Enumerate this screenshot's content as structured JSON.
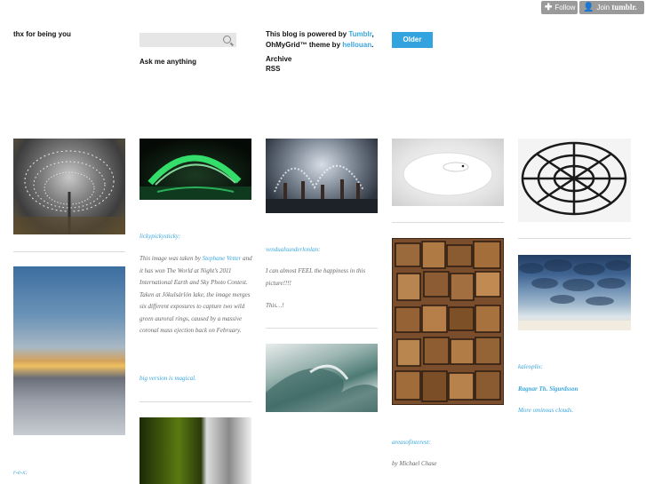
{
  "topbar": {
    "follow_label": "Follow",
    "join_label": "Join",
    "join_brand": "tumblr."
  },
  "blog": {
    "tagline": "thx for being you"
  },
  "search": {
    "placeholder": "",
    "ask_label": "Ask me anything"
  },
  "powered": {
    "prefix": "This blog is powered by",
    "tumblr": "Tumblr",
    "sep": ",",
    "theme": "OhMyGrid™ theme by",
    "author": "hellouan",
    "end": "."
  },
  "nav": {
    "archive": "Archive",
    "rss": "RSS",
    "older": "Older"
  },
  "posts": {
    "p2": {
      "source": "lickypickysticky:",
      "text_1": "This image was taken by",
      "photographer": "Stephane Vetter",
      "text_2": "and it has won The World at Night’s 2011 International Earth and Sky Photo Contest. Taken at Jökulsárlón lake, the image merges six different exposures to capture two wild green auroral rings, caused by a massive coronal mass ejection back on February.",
      "link": "big version is magical."
    },
    "p3": {
      "source": "vendualsunderlonlan:",
      "quote": "I can almost FEEL the happiness in this picture!!!!",
      "sub": "This…!"
    },
    "p4": {
      "source": "areasofinterest:",
      "credit": "by Michael Chase"
    },
    "p5": {
      "source": "kaleoplix:",
      "author": "Ragnar Th. Sigurdsson",
      "link": "More ominous clouds."
    },
    "p1": {
      "source": "r-e-x:"
    }
  },
  "colors": {
    "accent": "#33a3e0",
    "link": "#3aa6dd",
    "topbar": "#9a9a9a"
  }
}
